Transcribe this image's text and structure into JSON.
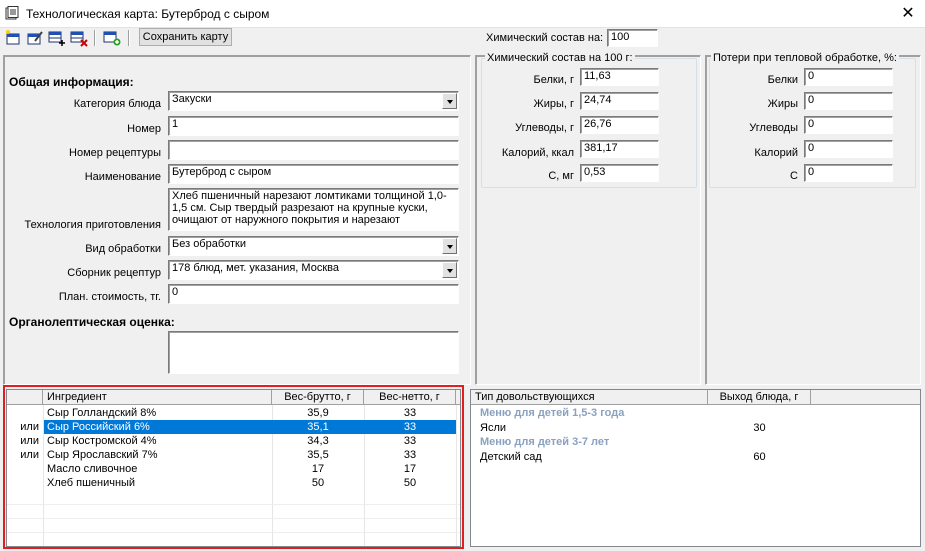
{
  "window": {
    "title": "Технологическая карта: Бутерброд с сыром",
    "close_glyph": "✕"
  },
  "toolbar": {
    "save_label": "Сохранить карту",
    "buttons": [
      "new-card-icon",
      "edit-card-icon",
      "add-row-icon",
      "delete-row-icon",
      "calc-icon"
    ],
    "chem_for_label": "Химический состав на:",
    "chem_for_value": "100"
  },
  "general": {
    "heading": "Общая информация:",
    "category_label": "Категория блюда",
    "category_value": "Закуски",
    "number_label": "Номер",
    "number_value": "1",
    "recipe_number_label": "Номер рецептуры",
    "recipe_number_value": "",
    "name_label": "Наименование",
    "name_value": "Бутерброд с сыром",
    "technology_label": "Технология приготовления",
    "technology_value": "Хлеб пшеничный нарезают ломтиками толщиной 1,0-1,5 см. Сыр твердый разрезают на крупные куски, очищают от наружного покрытия и нарезают",
    "processing_label": "Вид обработки",
    "processing_value": "Без обработки",
    "collection_label": "Сборник рецептур",
    "collection_value": "178 блюд, мет. указания, Москва",
    "cost_label": "План. стоимость, тг.",
    "cost_value": "0",
    "organoleptic_heading": "Органолептическая оценка:",
    "organoleptic_value": ""
  },
  "chem": {
    "legend": "Химический состав на 100 г:",
    "rows": [
      {
        "label": "Белки, г",
        "value": "11,63"
      },
      {
        "label": "Жиры, г",
        "value": "24,74"
      },
      {
        "label": "Углеводы, г",
        "value": "26,76"
      },
      {
        "label": "Калорий, ккал",
        "value": "381,17"
      },
      {
        "label": "С, мг",
        "value": "0,53"
      }
    ]
  },
  "losses": {
    "legend": "Потери при тепловой обработке, %:",
    "rows": [
      {
        "label": "Белки",
        "value": "0"
      },
      {
        "label": "Жиры",
        "value": "0"
      },
      {
        "label": "Углеводы",
        "value": "0"
      },
      {
        "label": "Калорий",
        "value": "0"
      },
      {
        "label": "С",
        "value": "0"
      }
    ]
  },
  "ingredients": {
    "headers": {
      "prefix": "",
      "name": "Ингредиент",
      "gross": "Вес-брутто, г",
      "net": "Вес-нетто, г"
    },
    "rows": [
      {
        "prefix": "",
        "name": "Сыр Голландский 8%",
        "gross": "35,9",
        "net": "33",
        "selected": false
      },
      {
        "prefix": "или",
        "name": "Сыр Российский 6%",
        "gross": "35,1",
        "net": "33",
        "selected": true
      },
      {
        "prefix": "или",
        "name": "Сыр Костромской 4%",
        "gross": "34,3",
        "net": "33",
        "selected": false
      },
      {
        "prefix": "или",
        "name": "Сыр Ярославский 7%",
        "gross": "35,5",
        "net": "33",
        "selected": false
      },
      {
        "prefix": "",
        "name": "Масло сливочное",
        "gross": "17",
        "net": "17",
        "selected": false
      },
      {
        "prefix": "",
        "name": "Хлеб пшеничный",
        "gross": "50",
        "net": "50",
        "selected": false
      }
    ]
  },
  "consumers": {
    "headers": {
      "type": "Тип довольствующихся",
      "output": "Выход блюда, г"
    },
    "groups": [
      {
        "title": "Меню для детей 1,5-3 года",
        "rows": [
          {
            "type": "Ясли",
            "output": "30"
          }
        ]
      },
      {
        "title": "Меню для детей 3-7 лет",
        "rows": [
          {
            "type": "Детский сад",
            "output": "60"
          }
        ]
      }
    ]
  },
  "colors": {
    "highlight_border": "#e02020",
    "selection": "#0078d7",
    "group_text": "#8aa1bf"
  }
}
